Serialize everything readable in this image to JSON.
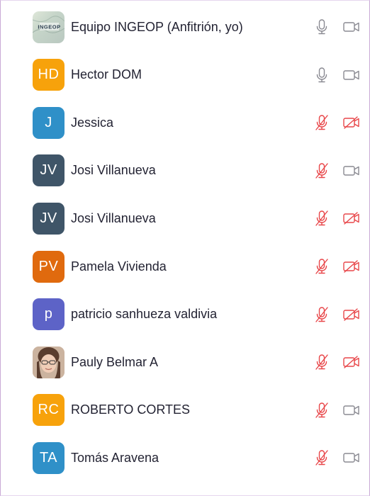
{
  "colors": {
    "muted_red": "#e8474a",
    "icon_gray": "#8a8a92",
    "text": "#232333"
  },
  "participants": [
    {
      "name": "Equipo INGEOP (Anfitrión, yo)",
      "initials": "",
      "avatar": "logo-image",
      "avatar_color": "#c6d5c9",
      "mic": "on",
      "video": "off-gray",
      "logo_text": "INGEOP"
    },
    {
      "name": "Hector DOM",
      "initials": "HD",
      "avatar_color": "#f7a20b",
      "mic": "on",
      "video": "gray"
    },
    {
      "name": "Jessica",
      "initials": "J",
      "avatar_color": "#2f90c8",
      "mic": "muted",
      "video": "stopped"
    },
    {
      "name": "Josi Villanueva",
      "initials": "JV",
      "avatar_color": "#3f5568",
      "mic": "muted",
      "video": "gray"
    },
    {
      "name": "Josi Villanueva",
      "initials": "JV",
      "avatar_color": "#3f5568",
      "mic": "muted",
      "video": "stopped"
    },
    {
      "name": "Pamela Vivienda",
      "initials": "PV",
      "avatar_color": "#e06a0e",
      "mic": "muted",
      "video": "stopped"
    },
    {
      "name": "patricio sanhueza valdivia",
      "initials": "p",
      "avatar_color": "#5d63c7",
      "mic": "muted",
      "video": "stopped"
    },
    {
      "name": "Pauly Belmar A",
      "initials": "",
      "avatar": "photo",
      "avatar_color": "#d6b8a2",
      "mic": "muted",
      "video": "stopped"
    },
    {
      "name": "ROBERTO CORTES",
      "initials": "RC",
      "avatar_color": "#f7a20b",
      "mic": "muted",
      "video": "gray"
    },
    {
      "name": "Tomás Aravena",
      "initials": "TA",
      "avatar_color": "#2f90c8",
      "mic": "muted",
      "video": "gray"
    }
  ]
}
